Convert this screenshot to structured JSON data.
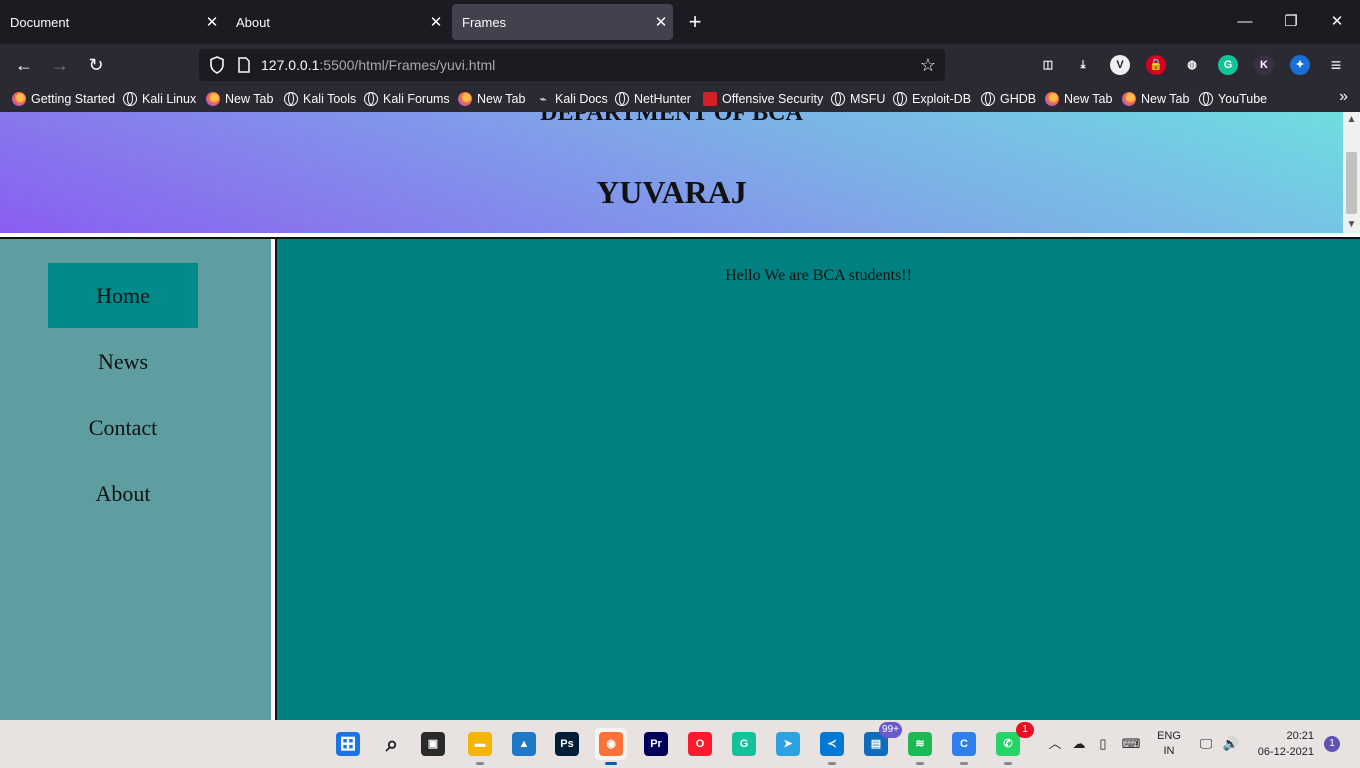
{
  "browser": {
    "tabs": [
      {
        "label": "Document",
        "active": false
      },
      {
        "label": "About",
        "active": false
      },
      {
        "label": "Frames",
        "active": true
      }
    ],
    "url_host": "127.0.0.1",
    "url_path": ":5500/html/Frames/yuvi.html",
    "new_tab_icon": "plus-icon",
    "window_controls": [
      "minimize-icon",
      "restore-icon",
      "close-icon"
    ],
    "extensions": [
      {
        "name": "pocket-icon",
        "glyph": "◫",
        "color": "#2b2a33"
      },
      {
        "name": "downloads-icon",
        "glyph": "⤓",
        "color": "#2b2a33"
      },
      {
        "name": "vpn-icon",
        "glyph": "V",
        "color": "#f0f0f4"
      },
      {
        "name": "lock-extension-icon",
        "glyph": "🔒",
        "color": "#d70022"
      },
      {
        "name": "cookie-icon",
        "glyph": "◍",
        "color": "#2b2a33"
      },
      {
        "name": "grammarly-icon",
        "glyph": "G",
        "color": "#15c39a"
      },
      {
        "name": "k-extension-icon",
        "glyph": "K",
        "color": "#3a2f45"
      },
      {
        "name": "gamepad-extension-icon",
        "glyph": "✦",
        "color": "#1a6fd6"
      }
    ]
  },
  "bookmarks": [
    {
      "label": "Getting Started",
      "icon": "fox"
    },
    {
      "label": "Kali Linux",
      "icon": "globe"
    },
    {
      "label": "New Tab",
      "icon": "fox"
    },
    {
      "label": "Kali Tools",
      "icon": "globe"
    },
    {
      "label": "Kali Forums",
      "icon": "globe"
    },
    {
      "label": "New Tab",
      "icon": "fox"
    },
    {
      "label": "Kali Docs",
      "icon": "kali"
    },
    {
      "label": "NetHunter",
      "icon": "globe"
    },
    {
      "label": "Offensive Security",
      "icon": "offsec"
    },
    {
      "label": "MSFU",
      "icon": "globe"
    },
    {
      "label": "Exploit-DB",
      "icon": "globe"
    },
    {
      "label": "GHDB",
      "icon": "globe"
    },
    {
      "label": "New Tab",
      "icon": "fox"
    },
    {
      "label": "New Tab",
      "icon": "fox"
    },
    {
      "label": "YouTube",
      "icon": "globe"
    }
  ],
  "page": {
    "department": "DEPARTMENT OF BCA",
    "site_name": "YUVARAJ",
    "menu": [
      {
        "label": "Home",
        "active": true
      },
      {
        "label": "News",
        "active": false
      },
      {
        "label": "Contact",
        "active": false
      },
      {
        "label": "About",
        "active": false
      }
    ],
    "greeting": "Hello We are BCA students!!"
  },
  "colors": {
    "side_frame": "#5f9ea0",
    "main_frame": "#008080",
    "menu_active": "#008b8b"
  },
  "taskbar": {
    "apps": [
      {
        "name": "start-icon",
        "glyph": "⊞",
        "bg": "#1a73e8",
        "running": false
      },
      {
        "name": "search-icon",
        "glyph": "⌕",
        "bg": "transparent",
        "running": false
      },
      {
        "name": "task-view-icon",
        "glyph": "▣",
        "bg": "#2a2a2a",
        "running": false
      },
      {
        "name": "file-explorer-icon",
        "glyph": "▬",
        "bg": "#f4b400",
        "running": true
      },
      {
        "name": "photos-icon",
        "glyph": "▲",
        "bg": "#1f78c8",
        "running": false
      },
      {
        "name": "photoshop-icon",
        "glyph": "Ps",
        "bg": "#001e36",
        "running": false
      },
      {
        "name": "firefox-icon",
        "glyph": "◉",
        "bg": "#ff7139",
        "running": true,
        "focused": true
      },
      {
        "name": "premiere-icon",
        "glyph": "Pr",
        "bg": "#00005b",
        "running": false
      },
      {
        "name": "opera-icon",
        "glyph": "O",
        "bg": "#ff1b2d",
        "running": false
      },
      {
        "name": "grammarly-app-icon",
        "glyph": "G",
        "bg": "#15c39a",
        "running": false
      },
      {
        "name": "telegram-icon",
        "glyph": "➤",
        "bg": "#2aa3e0",
        "running": false
      },
      {
        "name": "vscode-icon",
        "glyph": "≺",
        "bg": "#0078d4",
        "running": true
      },
      {
        "name": "calendar-icon",
        "glyph": "▤",
        "bg": "#0f6cbd",
        "running": false,
        "badge": "99+",
        "badge_color": "#6a5acd"
      },
      {
        "name": "spotify-icon",
        "glyph": "≋",
        "bg": "#1db954",
        "running": true
      },
      {
        "name": "c-app-icon",
        "glyph": "C",
        "bg": "#2f80ed",
        "running": true
      },
      {
        "name": "whatsapp-icon",
        "glyph": "✆",
        "bg": "#25d366",
        "running": true,
        "badge": "1",
        "badge_color": "#e81123"
      }
    ],
    "tray": {
      "lang_line1": "ENG",
      "lang_line2": "IN",
      "time": "20:21",
      "date": "06-12-2021",
      "notifications": "1"
    }
  }
}
